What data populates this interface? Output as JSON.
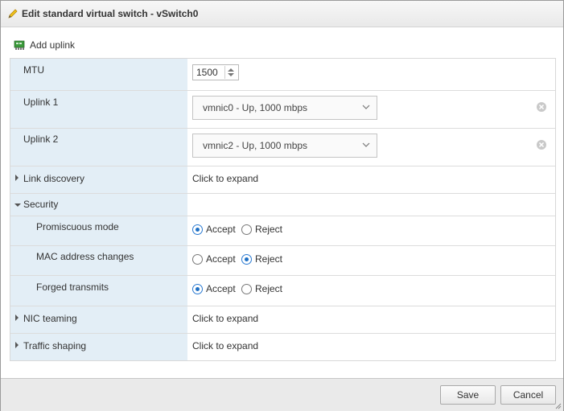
{
  "dialog": {
    "title": "Edit standard virtual switch - vSwitch0"
  },
  "toolbar": {
    "add_uplink_label": "Add uplink"
  },
  "mtu": {
    "label": "MTU",
    "value": "1500"
  },
  "uplinks": [
    {
      "label": "Uplink 1",
      "selected": "vmnic0 - Up, 1000 mbps"
    },
    {
      "label": "Uplink 2",
      "selected": "vmnic2 - Up, 1000 mbps"
    }
  ],
  "link_discovery": {
    "label": "Link discovery",
    "value": "Click to expand"
  },
  "security": {
    "label": "Security",
    "accept_label": "Accept",
    "reject_label": "Reject",
    "rows": [
      {
        "label": "Promiscuous mode",
        "selected": "Accept"
      },
      {
        "label": "MAC address changes",
        "selected": "Reject"
      },
      {
        "label": "Forged transmits",
        "selected": "Accept"
      }
    ]
  },
  "nic_teaming": {
    "label": "NIC teaming",
    "value": "Click to expand"
  },
  "traffic_shaping": {
    "label": "Traffic shaping",
    "value": "Click to expand"
  },
  "footer": {
    "save_label": "Save",
    "cancel_label": "Cancel"
  },
  "colors": {
    "label_column_bg": "#e3eef6",
    "radio_selected": "#1d6fc4",
    "footer_bg": "#eaeaea"
  },
  "icons": {
    "title": "pencil-icon",
    "add_uplink": "network-card-add-icon",
    "clear": "close-circle-icon",
    "dropdown": "chevron-down-icon",
    "expand": "caret-right-icon",
    "collapse": "caret-down-icon"
  }
}
